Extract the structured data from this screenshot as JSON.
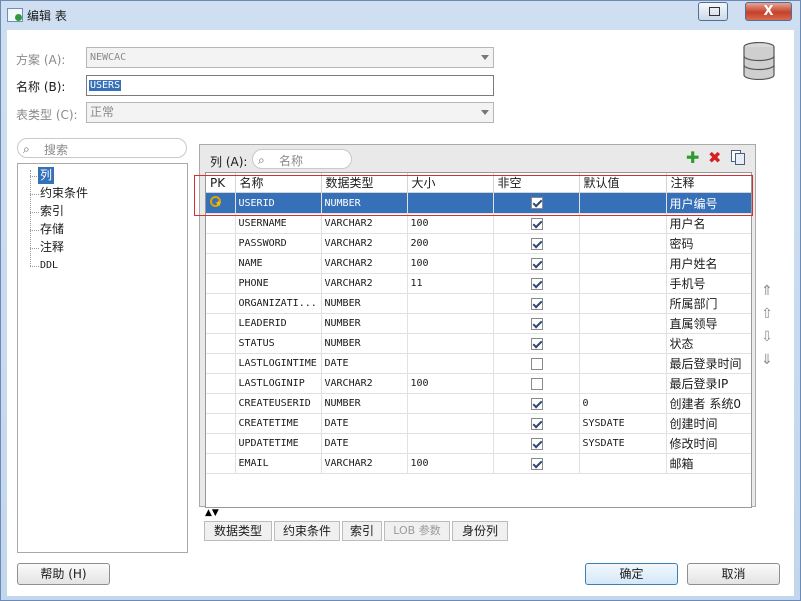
{
  "window": {
    "title": "编辑 表",
    "close_glyph": "X"
  },
  "form": {
    "scheme_label": "方案 (A):",
    "scheme_value": "NEWCAC",
    "name_label": "名称 (B):",
    "name_value": "USERS",
    "table_type_label": "表类型 (C):",
    "table_type_value": "正常"
  },
  "left": {
    "search_placeholder": "搜索",
    "tree": [
      "列",
      "约束条件",
      "索引",
      "存储",
      "注释",
      "DDL"
    ]
  },
  "columns_panel": {
    "label": "列 (A):",
    "search_placeholder": "名称",
    "headers": [
      "PK",
      "名称",
      "数据类型",
      "大小",
      "非空",
      "默认值",
      "注释"
    ],
    "rows": [
      {
        "pk": true,
        "name": "USERID",
        "type": "NUMBER",
        "size": "",
        "notnull": true,
        "default": "",
        "comment": "用户编号"
      },
      {
        "pk": false,
        "name": "USERNAME",
        "type": "VARCHAR2",
        "size": "100",
        "notnull": true,
        "default": "",
        "comment": "用户名"
      },
      {
        "pk": false,
        "name": "PASSWORD",
        "type": "VARCHAR2",
        "size": "200",
        "notnull": true,
        "default": "",
        "comment": "密码"
      },
      {
        "pk": false,
        "name": "NAME",
        "type": "VARCHAR2",
        "size": "100",
        "notnull": true,
        "default": "",
        "comment": "用户姓名"
      },
      {
        "pk": false,
        "name": "PHONE",
        "type": "VARCHAR2",
        "size": "11",
        "notnull": true,
        "default": "",
        "comment": "手机号"
      },
      {
        "pk": false,
        "name": "ORGANIZATI...",
        "type": "NUMBER",
        "size": "",
        "notnull": true,
        "default": "",
        "comment": "所属部门"
      },
      {
        "pk": false,
        "name": "LEADERID",
        "type": "NUMBER",
        "size": "",
        "notnull": true,
        "default": "",
        "comment": "直属领导"
      },
      {
        "pk": false,
        "name": "STATUS",
        "type": "NUMBER",
        "size": "",
        "notnull": true,
        "default": "",
        "comment": "状态"
      },
      {
        "pk": false,
        "name": "LASTLOGINTIME",
        "type": "DATE",
        "size": "",
        "notnull": false,
        "default": "",
        "comment": "最后登录时间"
      },
      {
        "pk": false,
        "name": "LASTLOGINIP",
        "type": "VARCHAR2",
        "size": "100",
        "notnull": false,
        "default": "",
        "comment": "最后登录IP"
      },
      {
        "pk": false,
        "name": "CREATEUSERID",
        "type": "NUMBER",
        "size": "",
        "notnull": true,
        "default": "0",
        "comment": "创建者 系统0"
      },
      {
        "pk": false,
        "name": "CREATETIME",
        "type": "DATE",
        "size": "",
        "notnull": true,
        "default": "SYSDATE",
        "comment": "创建时间"
      },
      {
        "pk": false,
        "name": "UPDATETIME",
        "type": "DATE",
        "size": "",
        "notnull": true,
        "default": "SYSDATE",
        "comment": "修改时间"
      },
      {
        "pk": false,
        "name": "EMAIL",
        "type": "VARCHAR2",
        "size": "100",
        "notnull": true,
        "default": "",
        "comment": "邮箱"
      }
    ]
  },
  "tabs": [
    {
      "label": "数据类型",
      "enabled": true
    },
    {
      "label": "约束条件",
      "enabled": true
    },
    {
      "label": "索引",
      "enabled": true
    },
    {
      "label": "LOB 参数",
      "enabled": false
    },
    {
      "label": "身份列",
      "enabled": true
    }
  ],
  "footer": {
    "help": "帮助 (H)",
    "ok": "确定",
    "cancel": "取消"
  },
  "colors": {
    "selection": "#3670b8",
    "add_icon": "#2f9a2f",
    "delete_icon": "#d42020",
    "highlight_frame": "#d43030"
  }
}
